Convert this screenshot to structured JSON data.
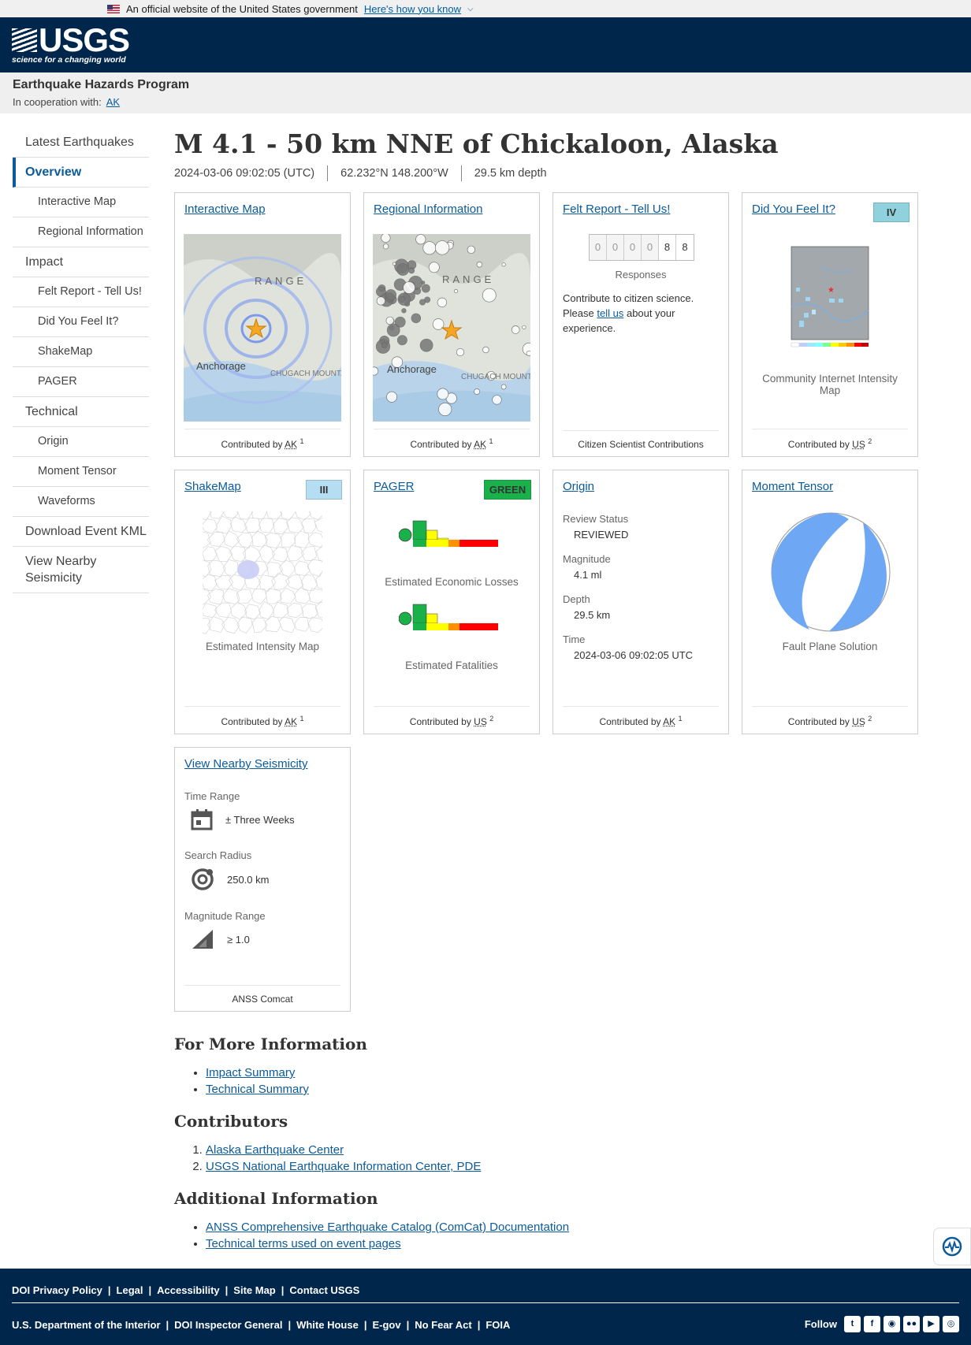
{
  "banner": {
    "text": "An official website of the United States government",
    "link": "Here's how you know"
  },
  "header": {
    "logo_text": "USGS",
    "logo_tagline": "science for a changing world"
  },
  "subheader": {
    "program": "Earthquake Hazards Program",
    "coop_label": "In cooperation with:",
    "coop_link": "AK"
  },
  "nav": [
    {
      "label": "Latest Earthquakes",
      "level": "top"
    },
    {
      "label": "Overview",
      "level": "top",
      "active": true
    },
    {
      "label": "Interactive Map",
      "level": "sub"
    },
    {
      "label": "Regional Information",
      "level": "sub"
    },
    {
      "label": "Impact",
      "level": "top"
    },
    {
      "label": "Felt Report - Tell Us!",
      "level": "sub"
    },
    {
      "label": "Did You Feel It?",
      "level": "sub"
    },
    {
      "label": "ShakeMap",
      "level": "sub"
    },
    {
      "label": "PAGER",
      "level": "sub"
    },
    {
      "label": "Technical",
      "level": "top"
    },
    {
      "label": "Origin",
      "level": "sub"
    },
    {
      "label": "Moment Tensor",
      "level": "sub"
    },
    {
      "label": "Waveforms",
      "level": "sub"
    },
    {
      "label": "Download Event KML",
      "level": "top"
    },
    {
      "label": "View Nearby Seismicity",
      "level": "top"
    }
  ],
  "event": {
    "title": "M 4.1 - 50 km NNE of Chickaloon, Alaska",
    "time": "2024-03-06 09:02:05 (UTC)",
    "location": "62.232°N 148.200°W",
    "depth": "29.5 km depth"
  },
  "cards": {
    "interactive_map": {
      "title": "Interactive Map",
      "contrib": "Contributed by",
      "net": "AK",
      "ref": "1",
      "map_labels": [
        "RANGE",
        "Anchorage",
        "CHUGACH MOUNTAINS"
      ]
    },
    "regional": {
      "title": "Regional Information",
      "contrib": "Contributed by",
      "net": "AK",
      "ref": "1",
      "map_labels": [
        "RANGE",
        "Anchorage",
        "CHUGACH MOUNTAINS"
      ]
    },
    "felt": {
      "title": "Felt Report - Tell Us!",
      "digits": [
        "0",
        "0",
        "0",
        "0",
        "8",
        "8"
      ],
      "responses": "Responses",
      "text1": "Contribute to citizen science. Please",
      "link": "tell us",
      "text2": "about your experience.",
      "foot": "Citizen Scientist Contributions"
    },
    "dyfi": {
      "title": "Did You Feel It?",
      "badge": "IV",
      "badge_color": "#8fd2dd",
      "caption": "Community Internet Intensity Map",
      "contrib": "Contributed by",
      "net": "US",
      "ref": "2"
    },
    "shakemap": {
      "title": "ShakeMap",
      "badge": "III",
      "badge_color": "#b5def2",
      "caption": "Estimated Intensity Map",
      "contrib": "Contributed by",
      "net": "AK",
      "ref": "1"
    },
    "pager": {
      "title": "PAGER",
      "badge": "GREEN",
      "badge_color": "#1ab14a",
      "caption_econ": "Estimated Economic Losses",
      "caption_fatal": "Estimated Fatalities",
      "contrib": "Contributed by",
      "net": "US",
      "ref": "2"
    },
    "origin": {
      "title": "Origin",
      "fields": [
        {
          "label": "Review Status",
          "value": "REVIEWED"
        },
        {
          "label": "Magnitude",
          "value": "4.1 ml"
        },
        {
          "label": "Depth",
          "value": "29.5 km"
        },
        {
          "label": "Time",
          "value": "2024-03-06 09:02:05 UTC"
        }
      ],
      "contrib": "Contributed by",
      "net": "AK",
      "ref": "1"
    },
    "moment_tensor": {
      "title": "Moment Tensor",
      "caption": "Fault Plane Solution",
      "contrib": "Contributed by",
      "net": "US",
      "ref": "2",
      "beach_color": "#6ea8f5"
    },
    "nearby": {
      "title": "View Nearby Seismicity",
      "time_label": "Time Range",
      "time_value": "± Three Weeks",
      "radius_label": "Search Radius",
      "radius_value": "250.0 km",
      "mag_label": "Magnitude Range",
      "mag_value": "≥ 1.0",
      "foot": "ANSS Comcat"
    }
  },
  "more_info": {
    "heading": "For More Information",
    "links": [
      "Impact Summary",
      "Technical Summary"
    ]
  },
  "contributors": {
    "heading": "Contributors",
    "links": [
      "Alaska Earthquake Center",
      "USGS National Earthquake Information Center, PDE"
    ]
  },
  "additional": {
    "heading": "Additional Information",
    "links": [
      "ANSS Comprehensive Earthquake Catalog (ComCat) Documentation",
      "Technical terms used on event pages"
    ]
  },
  "footer": {
    "row1": [
      "DOI Privacy Policy",
      "Legal",
      "Accessibility",
      "Site Map",
      "Contact USGS"
    ],
    "row2": [
      "U.S. Department of the Interior",
      "DOI Inspector General",
      "White House",
      "E-gov",
      "No Fear Act",
      "FOIA"
    ],
    "follow": "Follow",
    "social": [
      "twitter-icon",
      "facebook-icon",
      "github-icon",
      "flickr-icon",
      "youtube-icon",
      "instagram-icon"
    ]
  }
}
